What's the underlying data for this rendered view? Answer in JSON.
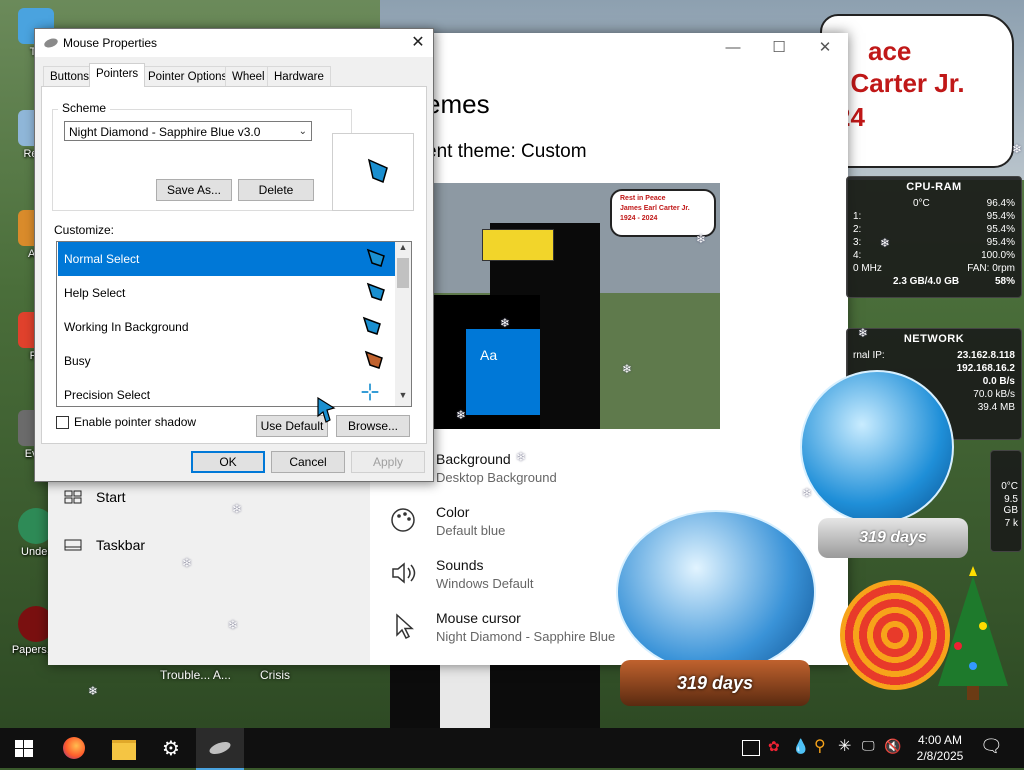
{
  "desktop": {
    "icons": [
      {
        "label": "Th",
        "color": "#4aa3df"
      },
      {
        "label": "Recy",
        "color": "#8fb6d8"
      },
      {
        "label": "Act",
        "color": "#d98b2b"
      },
      {
        "label": "Fir",
        "color": "#e0412c"
      },
      {
        "label": "Ever",
        "color": "#6b6b6b"
      },
      {
        "label": "Under",
        "color": "#2e8b57"
      },
      {
        "label": "Papers, P",
        "color": "#7a1010"
      }
    ],
    "taskbar_labels": [
      "Trouble... A...",
      "Crisis"
    ],
    "speech_lines": [
      "ace",
      "l Carter Jr.",
      "24"
    ]
  },
  "gadgets": {
    "cpu": {
      "title": "CPU-RAM",
      "temp": "0°C",
      "total": "96.4%",
      "cores": [
        {
          "label": "1:",
          "value": "95.4%"
        },
        {
          "label": "2:",
          "value": "95.4%"
        },
        {
          "label": "3:",
          "value": "95.4%"
        },
        {
          "label": "4:",
          "value": "100.0%"
        }
      ],
      "freq": "0 MHz",
      "fan": "FAN: 0rpm",
      "ram": "2.3 GB/4.0 GB",
      "ram_pct": "58%"
    },
    "network": {
      "title": "NETWORK",
      "internal_label": "rnal IP:",
      "internal_ip": "23.162.8.118",
      "external_ip": "192.168.16.2",
      "rates": [
        "0.0 B/s",
        "70.0 kB/s",
        "39.4 MB"
      ],
      "extra": [
        "0°C",
        "9.5 GB",
        "7 k"
      ]
    }
  },
  "globes": {
    "days_left": "319 days",
    "days_right": "319 days"
  },
  "settings": {
    "page_title": "emes",
    "current_theme": "ent theme: Custom",
    "left_items": [
      {
        "label": "Start",
        "icon": "start-layout-icon"
      },
      {
        "label": "Taskbar",
        "icon": "taskbar-icon"
      }
    ],
    "preview": {
      "sample": "Aa",
      "speech_lines": [
        "Rest in Peace",
        "James Earl Carter Jr.",
        "1924 - 2024"
      ]
    },
    "items": [
      {
        "title": "Background",
        "sub": "Desktop Background",
        "icon": "image-icon"
      },
      {
        "title": "Color",
        "sub": "Default blue",
        "icon": "palette-icon"
      },
      {
        "title": "Sounds",
        "sub": "Windows Default",
        "icon": "speaker-icon"
      },
      {
        "title": "Mouse cursor",
        "sub": "Night Diamond - Sapphire Blue",
        "icon": "cursor-icon"
      }
    ]
  },
  "mouse": {
    "title": "Mouse Properties",
    "tabs": [
      "Buttons",
      "Pointers",
      "Pointer Options",
      "Wheel",
      "Hardware"
    ],
    "active_tab": "Pointers",
    "scheme_label": "Scheme",
    "scheme_value": "Night Diamond - Sapphire Blue v3.0",
    "save_as": "Save As...",
    "delete": "Delete",
    "customize_label": "Customize:",
    "cursors": [
      {
        "name": "Normal Select",
        "selected": true
      },
      {
        "name": "Help Select",
        "selected": false
      },
      {
        "name": "Working In Background",
        "selected": false
      },
      {
        "name": "Busy",
        "selected": false
      },
      {
        "name": "Precision Select",
        "selected": false
      }
    ],
    "shadow_label": "Enable pointer shadow",
    "shadow_checked": false,
    "use_default": "Use Default",
    "browse": "Browse...",
    "ok": "OK",
    "cancel": "Cancel",
    "apply": "Apply"
  },
  "taskbar": {
    "time": "4:00 AM",
    "date": "2/8/2025",
    "pinned": [
      "windows-start-icon",
      "firefox-icon",
      "file-explorer-icon",
      "settings-gear-icon",
      "mouse-properties-icon"
    ]
  },
  "colors": {
    "accent": "#0078d7",
    "gadget_bg": "#191919",
    "speech_text": "#c01818"
  }
}
